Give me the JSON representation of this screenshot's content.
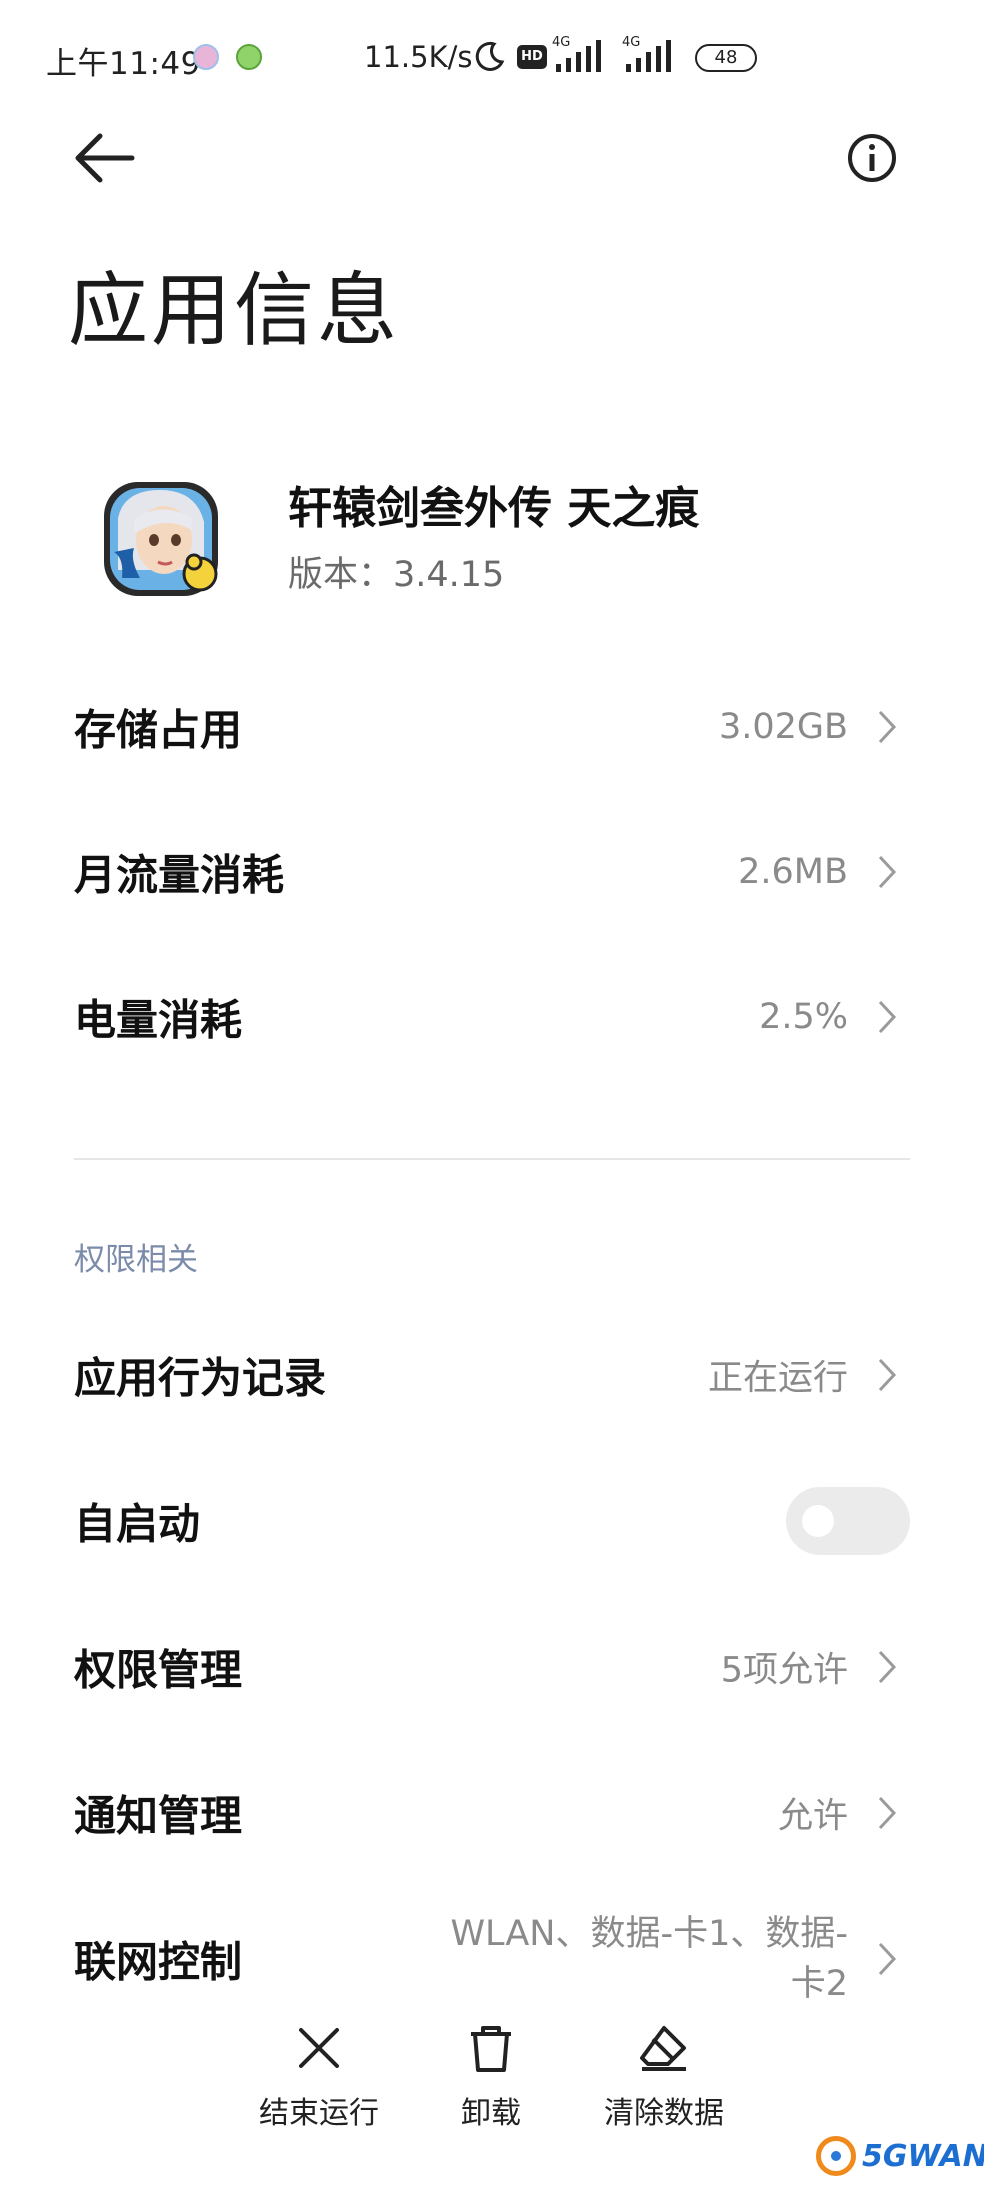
{
  "status_bar": {
    "time": "上午11:49",
    "net_speed": "11.5K/s",
    "hd": "HD",
    "signal_1": "4G",
    "signal_2": "4G",
    "battery": "48"
  },
  "header": {
    "title": "应用信息"
  },
  "app": {
    "name": "轩辕剑叁外传 天之痕",
    "version": "版本：3.4.15"
  },
  "usage_rows": [
    {
      "label": "存储占用",
      "value": "3.02GB"
    },
    {
      "label": "月流量消耗",
      "value": "2.6MB"
    },
    {
      "label": "电量消耗",
      "value": "2.5%"
    }
  ],
  "permissions": {
    "section_title": "权限相关",
    "behavior_record": {
      "label": "应用行为记录",
      "value": "正在运行"
    },
    "autostart": {
      "label": "自启动",
      "enabled": false
    },
    "permission_manage": {
      "label": "权限管理",
      "value": "5项允许"
    },
    "notification_manage": {
      "label": "通知管理",
      "value": "允许"
    },
    "network_control": {
      "label": "联网控制",
      "value": "WLAN、数据-卡1、数据-卡2"
    }
  },
  "bottom_bar": {
    "force_stop": "结束运行",
    "uninstall": "卸载",
    "clear_data": "清除数据"
  },
  "watermark": {
    "text": "5GWAN"
  },
  "colors": {
    "section_title": "#7b8cab",
    "value_text": "#8a8a8a",
    "toggle_off": "#ebebeb"
  }
}
